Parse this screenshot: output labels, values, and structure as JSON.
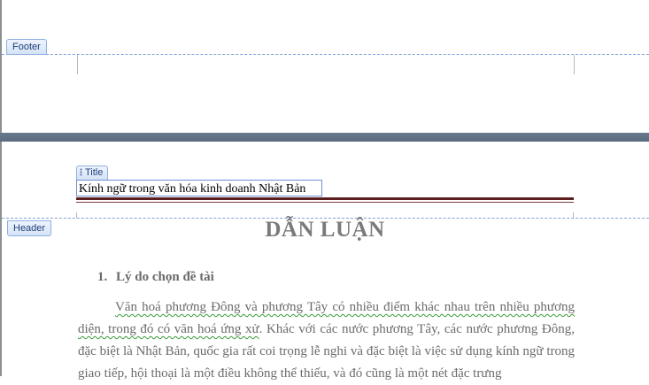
{
  "footer": {
    "label": "Footer"
  },
  "header": {
    "label": "Header"
  },
  "title_control": {
    "tag_label": "Title",
    "value": "Kính ngữ trong văn hóa kinh doanh Nhật Bản"
  },
  "document": {
    "heading": "DẪN LUẬN",
    "section_number": "1.",
    "section_title": "Lý do chọn đề tài",
    "paragraph_part1": "Văn hoá phương Đông và phương Tây có nhiều điểm khác nhau trên nhiều phương diện, trong đó có văn hoá ứng xử",
    "paragraph_part2": ". Khác với các nước phương Tây, các nước phương Đông, đặc biệt là Nhật Bản, quốc gia rất coi trọng lễ nghi và đặc biệt là việc sử dụng kính ngữ trong giao tiếp, hội thoại là một điều không thể thiếu, và đó cũng là một nét đặc trưng"
  },
  "colors": {
    "rule": "#5a1e1e",
    "dashed_boundary": "#7fa3d8",
    "gap": "#5a6b80"
  }
}
